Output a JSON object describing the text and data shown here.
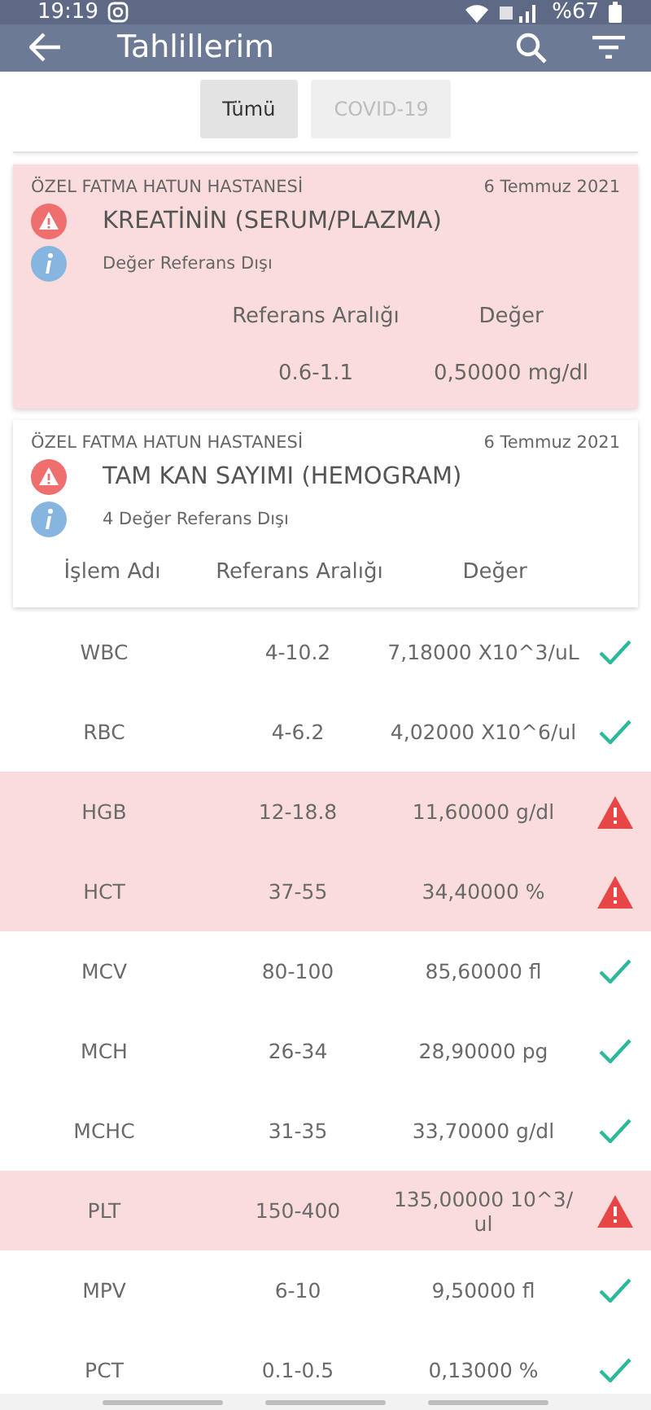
{
  "status_bar": {
    "time": "19:19",
    "battery": "%67"
  },
  "app_bar": {
    "title": "Tahlillerim"
  },
  "filters": [
    {
      "label": "Tümü",
      "selected": true
    },
    {
      "label": "COVID-19",
      "selected": false
    }
  ],
  "cards": [
    {
      "hospital": "ÖZEL FATMA HATUN HASTANESİ",
      "date": "6 Temmuz 2021",
      "test": "KREATİNİN (SERUM/PLAZMA)",
      "note": "Değer Referans Dışı",
      "abnormal": true,
      "columns": [
        "Referans Aralığı",
        "Değer"
      ],
      "rows": [
        {
          "range": "0.6-1.1",
          "value": "0,50000 mg/dl"
        }
      ]
    },
    {
      "hospital": "ÖZEL FATMA HATUN HASTANESİ",
      "date": "6 Temmuz 2021",
      "test": "TAM KAN SAYIMI (HEMOGRAM)",
      "note": "4 Değer Referans Dışı",
      "abnormal": false,
      "columns": [
        "İşlem Adı",
        "Referans Aralığı",
        "Değer"
      ]
    }
  ],
  "results": [
    {
      "name": "WBC",
      "range": "4-10.2",
      "value": "7,18000 X10^3/uL",
      "abnormal": false
    },
    {
      "name": "RBC",
      "range": "4-6.2",
      "value": "4,02000 X10^6/ul",
      "abnormal": false
    },
    {
      "name": "HGB",
      "range": "12-18.8",
      "value": "11,60000 g/dl",
      "abnormal": true
    },
    {
      "name": "HCT",
      "range": "37-55",
      "value": "34,40000 %",
      "abnormal": true
    },
    {
      "name": "MCV",
      "range": "80-100",
      "value": "85,60000 fl",
      "abnormal": false
    },
    {
      "name": "MCH",
      "range": "26-34",
      "value": "28,90000 pg",
      "abnormal": false
    },
    {
      "name": "MCHC",
      "range": "31-35",
      "value": "33,70000 g/dl",
      "abnormal": false
    },
    {
      "name": "PLT",
      "range": "150-400",
      "value": "135,00000 10^3/ul",
      "abnormal": true
    },
    {
      "name": "MPV",
      "range": "6-10",
      "value": "9,50000 fl",
      "abnormal": false
    },
    {
      "name": "PCT",
      "range": "0.1-0.5",
      "value": "0,13000 %",
      "abnormal": false
    }
  ]
}
